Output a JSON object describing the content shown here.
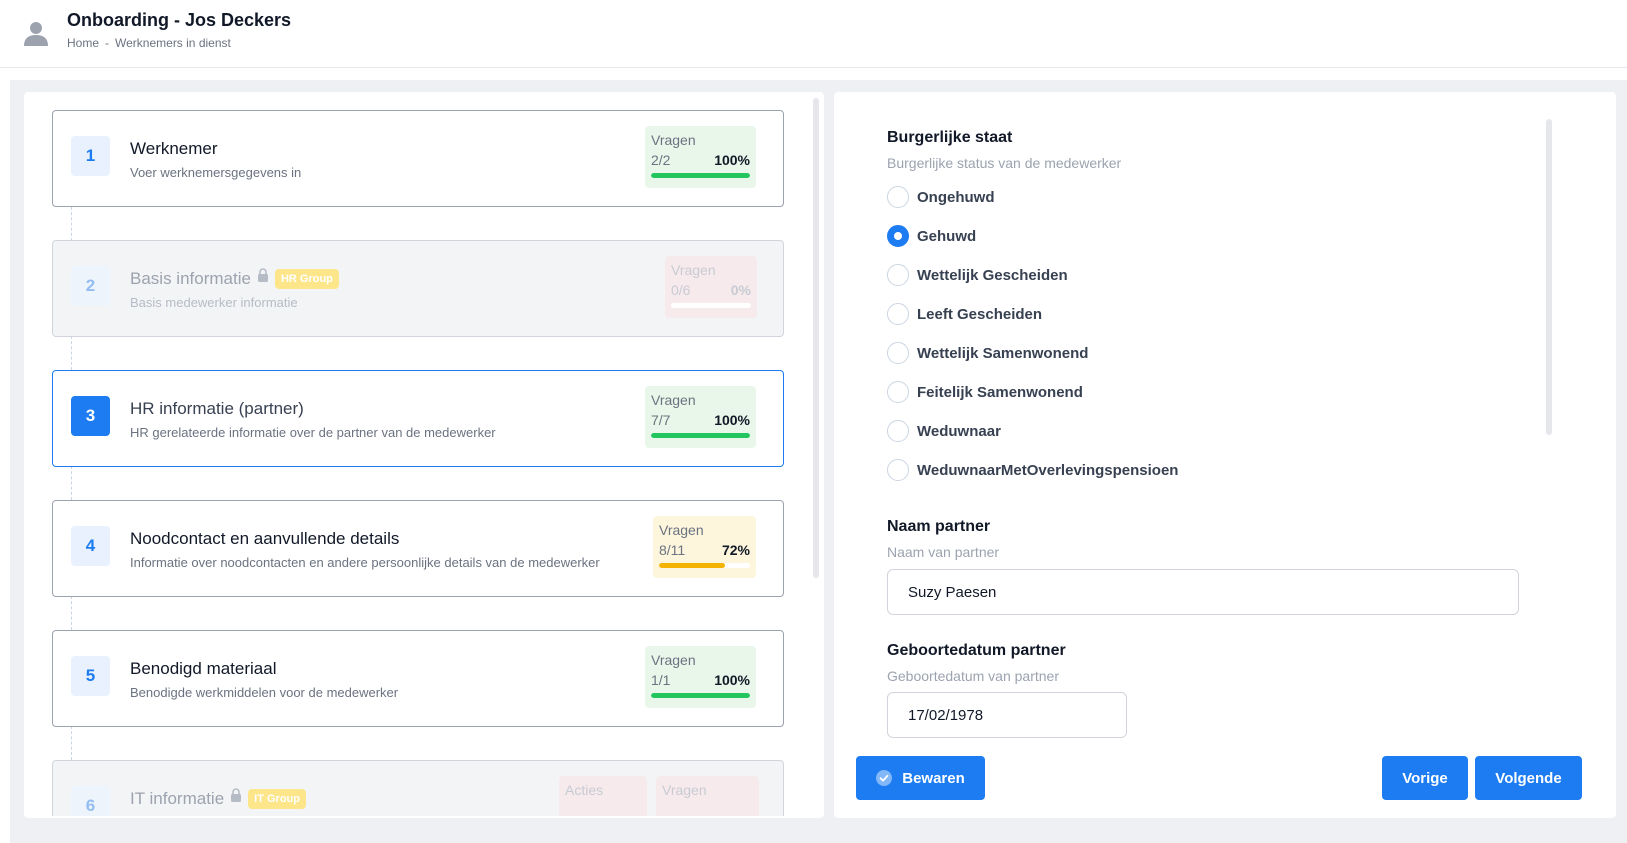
{
  "header": {
    "title": "Onboarding - Jos Deckers",
    "breadcrumb": [
      "Home",
      "-",
      "Werknemers in dienst"
    ]
  },
  "steps": [
    {
      "number": "1",
      "title": "Werknemer",
      "subtitle": "Voer werknemersgegevens in",
      "state": "done",
      "questions": {
        "label": "Vragen",
        "count": "2/2",
        "percent": "100%",
        "progress": 1.0
      }
    },
    {
      "number": "2",
      "title": "Basis informatie",
      "subtitle": "Basis medewerker informatie",
      "state": "locked",
      "group": "HR Group",
      "questions": {
        "label": "Vragen",
        "count": "0/6",
        "percent": "0%",
        "progress": 0.0
      }
    },
    {
      "number": "3",
      "title": "HR informatie (partner)",
      "subtitle": "HR gerelateerde informatie over de partner van de medewerker",
      "state": "active",
      "questions": {
        "label": "Vragen",
        "count": "7/7",
        "percent": "100%",
        "progress": 1.0
      }
    },
    {
      "number": "4",
      "title": "Noodcontact en aanvullende details",
      "subtitle": "Informatie over noodcontacten en andere persoonlijke details van de medewerker",
      "state": "partial",
      "questions": {
        "label": "Vragen",
        "count": "8/11",
        "percent": "72%",
        "progress": 0.72
      }
    },
    {
      "number": "5",
      "title": "Benodigd materiaal",
      "subtitle": "Benodigde werkmiddelen voor de medewerker",
      "state": "done",
      "questions": {
        "label": "Vragen",
        "count": "1/1",
        "percent": "100%",
        "progress": 1.0
      }
    },
    {
      "number": "6",
      "title": "IT informatie",
      "subtitle": "",
      "state": "locked",
      "group": "IT Group",
      "actions_label": "Acties",
      "questions": {
        "label": "Vragen"
      }
    }
  ],
  "form": {
    "civil_status": {
      "title": "Burgerlijke staat",
      "subtitle": "Burgerlijke status van de medewerker",
      "options": [
        "Ongehuwd",
        "Gehuwd",
        "Wettelijk Gescheiden",
        "Leeft Gescheiden",
        "Wettelijk Samenwonend",
        "Feitelijk Samenwonend",
        "Weduwnaar",
        "WeduwnaarMetOverlevingspensioen"
      ],
      "selected": "Gehuwd"
    },
    "partner_name": {
      "title": "Naam partner",
      "subtitle": "Naam van partner",
      "value": "Suzy Paesen"
    },
    "partner_birthdate": {
      "title": "Geboortedatum partner",
      "subtitle": "Geboortedatum van partner",
      "value": "17/02/1978"
    }
  },
  "buttons": {
    "save": "Bewaren",
    "previous": "Vorige",
    "next": "Volgende"
  },
  "colors": {
    "primary": "#1d7cf2",
    "success": "#22c55e",
    "warning": "#f5b301",
    "group_badge": "#fde68a"
  },
  "icons": {
    "avatar": "user-avatar-icon",
    "lock": "lock-icon",
    "save": "check-circle-icon"
  }
}
